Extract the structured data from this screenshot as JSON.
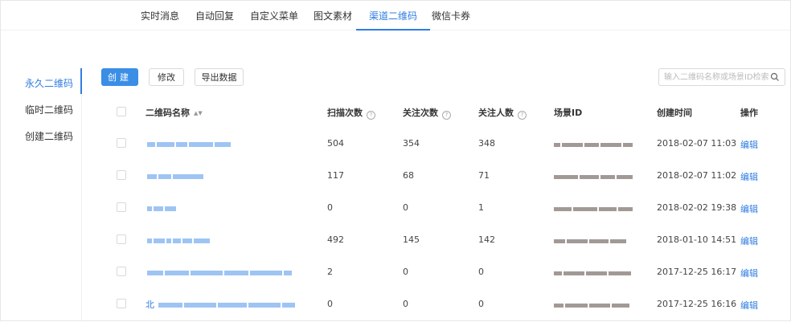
{
  "tabs": [
    "实时消息",
    "自动回复",
    "自定义菜单",
    "图文素材",
    "渠道二维码",
    "微信卡券"
  ],
  "sidebar": {
    "items": [
      "永久二维码",
      "临时二维码",
      "创建二维码"
    ]
  },
  "toolbar": {
    "create_label": "创建",
    "edit_label": "修改",
    "export_label": "导出数据",
    "search_placeholder": "输入二维码名称或场景ID检索"
  },
  "table": {
    "headers": {
      "name": "二维码名称",
      "scans": "扫描次数",
      "follows": "关注次数",
      "followers": "关注人数",
      "scene_id": "场景ID",
      "created": "创建时间",
      "actions": "操作"
    },
    "rows": [
      {
        "scans": "504",
        "follows": "354",
        "followers": "348",
        "created": "2018-02-07 11:03",
        "action": "编辑"
      },
      {
        "scans": "117",
        "follows": "68",
        "followers": "71",
        "created": "2018-02-07 11:02",
        "action": "编辑"
      },
      {
        "scans": "0",
        "follows": "0",
        "followers": "1",
        "created": "2018-02-02 19:38",
        "action": "编辑"
      },
      {
        "scans": "492",
        "follows": "145",
        "followers": "142",
        "created": "2018-01-10 14:51",
        "action": "编辑"
      },
      {
        "scans": "2",
        "follows": "0",
        "followers": "0",
        "created": "2017-12-25 16:17",
        "action": "编辑"
      },
      {
        "scans": "0",
        "follows": "0",
        "followers": "0",
        "created": "2017-12-25 16:16",
        "action": "编辑",
        "name_prefix": "北"
      }
    ]
  },
  "colors": {
    "accent": "#2f7de1",
    "primary_button": "#3a8ee6",
    "blurred_name": "#6aa4ec"
  }
}
